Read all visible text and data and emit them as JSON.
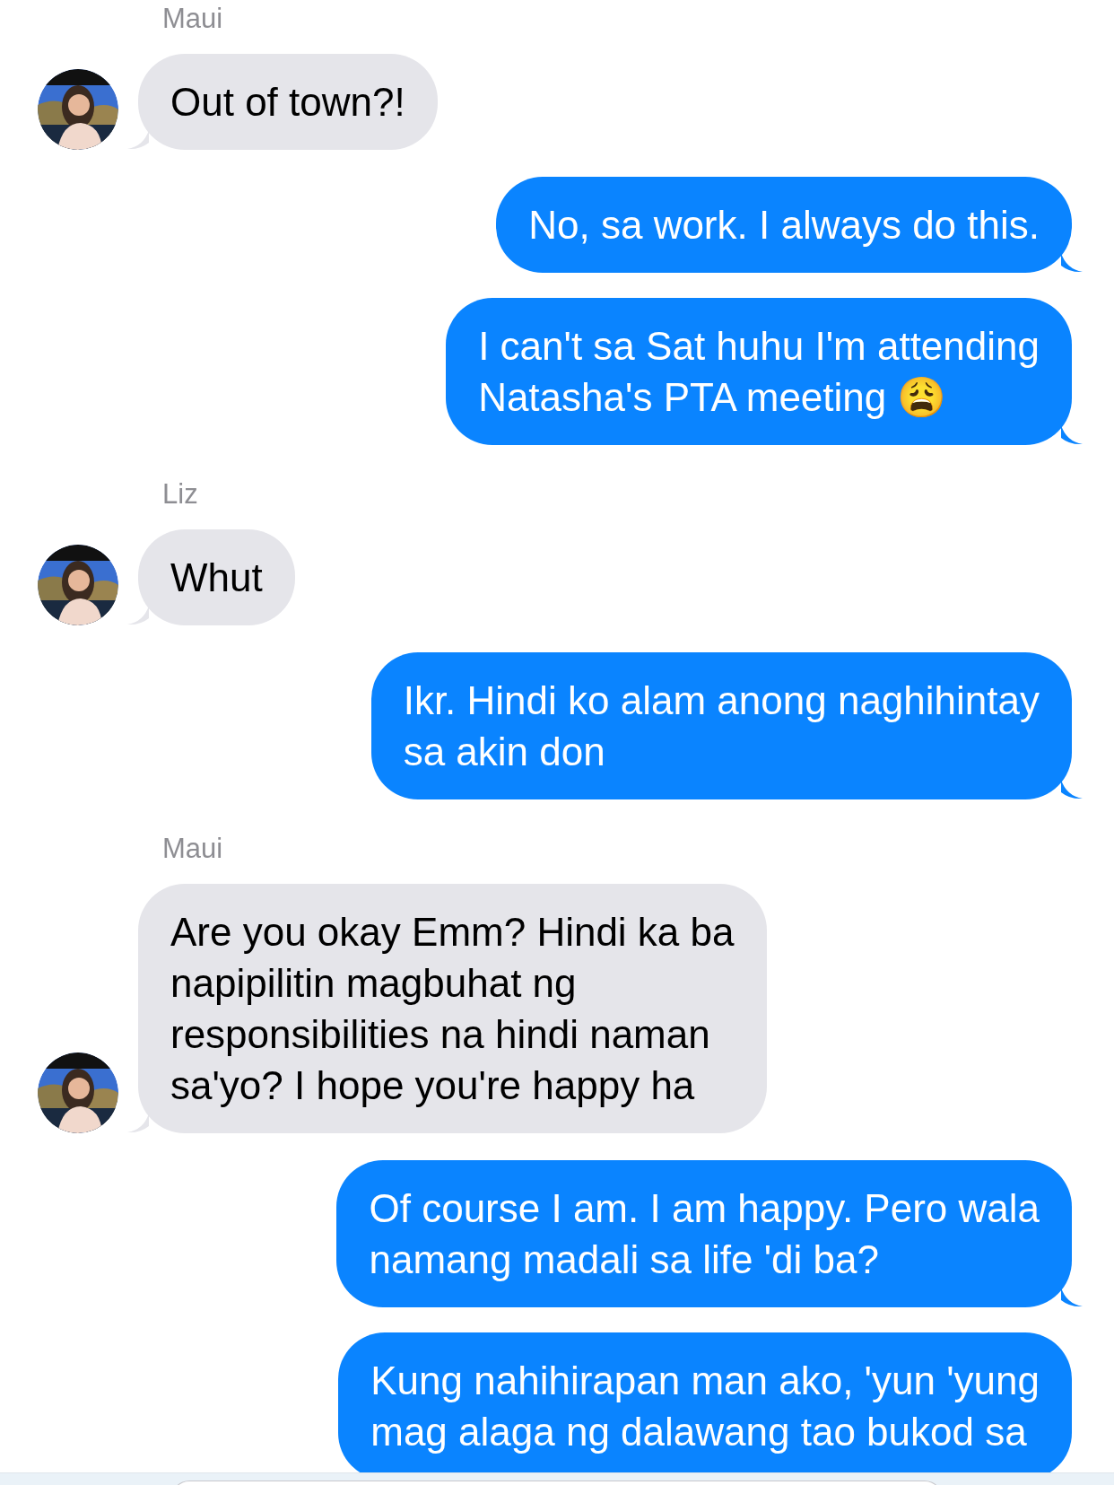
{
  "messages": [
    {
      "kind": "name",
      "text": "Maui"
    },
    {
      "kind": "received",
      "avatar": true,
      "lines": [
        "Out of town?!"
      ]
    },
    {
      "kind": "sent",
      "lines": [
        "No, sa work. I always do this."
      ]
    },
    {
      "kind": "sent",
      "lines": [
        "I can't sa Sat huhu I'm attending",
        "Natasha's PTA meeting 😩"
      ]
    },
    {
      "kind": "name",
      "text": "Liz"
    },
    {
      "kind": "received",
      "avatar": true,
      "lines": [
        "Whut"
      ]
    },
    {
      "kind": "sent",
      "lines": [
        "Ikr. Hindi ko alam anong naghihintay",
        "sa akin don"
      ]
    },
    {
      "kind": "name",
      "text": "Maui"
    },
    {
      "kind": "received",
      "avatar": true,
      "lines": [
        "Are you okay Emm? Hindi ka ba",
        "napipilitin magbuhat ng",
        "responsibilities na hindi naman",
        "sa'yo? I hope you're happy ha"
      ]
    },
    {
      "kind": "sent",
      "lines": [
        "Of course I am. I am happy. Pero wala",
        "namang madali sa life 'di ba?"
      ]
    },
    {
      "kind": "sent",
      "lines": [
        "Kung nahihirapan man ako, 'yun 'yung",
        "mag alaga ng dalawang tao bukod sa"
      ]
    }
  ]
}
